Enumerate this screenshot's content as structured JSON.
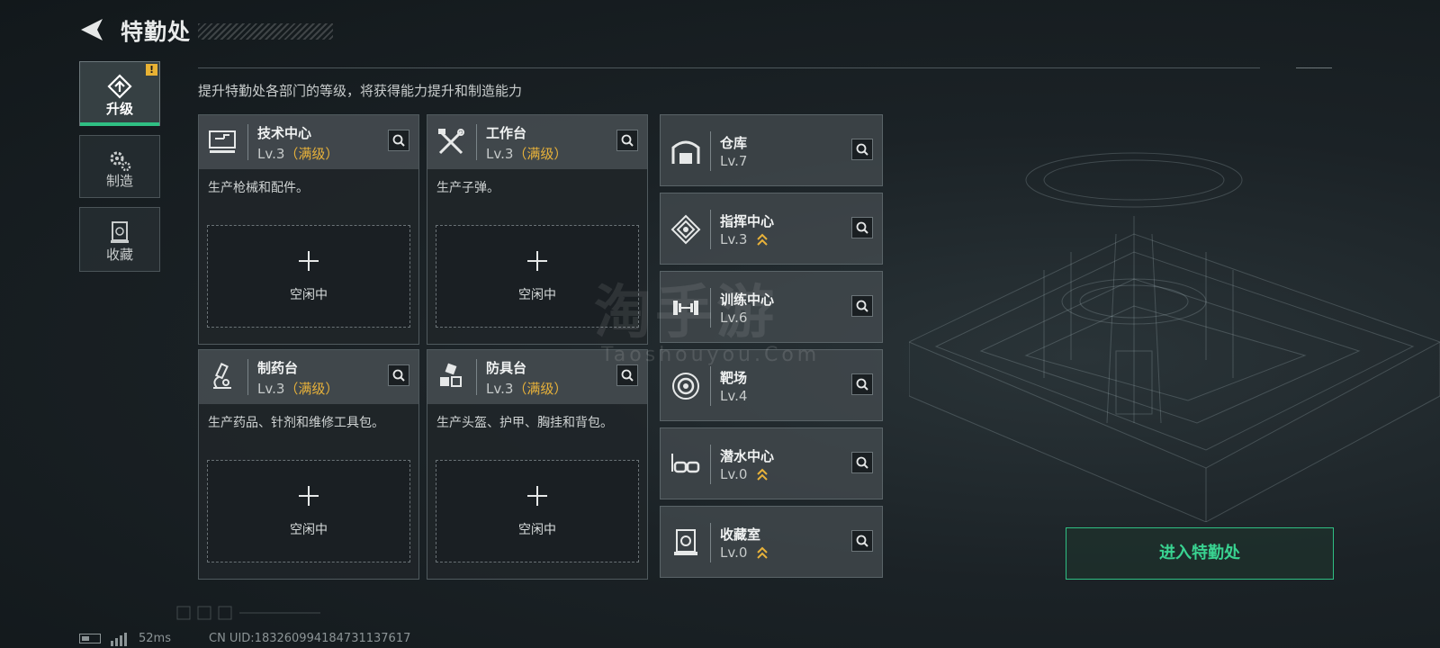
{
  "header": {
    "title": "特勤处"
  },
  "sidebar": {
    "items": [
      {
        "label": "升级",
        "icon": "upgrade-icon",
        "active": true,
        "badge": "!"
      },
      {
        "label": "制造",
        "icon": "gears-icon",
        "active": false
      },
      {
        "label": "收藏",
        "icon": "collection-icon",
        "active": false
      }
    ]
  },
  "subtitle": "提升特勤处各部门的等级，将获得能力提升和制造能力",
  "main_cards": [
    {
      "name": "技术中心",
      "level": "Lv.3",
      "max": "（满级）",
      "desc": "生产枪械和配件。",
      "slot": "空闲中",
      "icon": "computer-icon"
    },
    {
      "name": "工作台",
      "level": "Lv.3",
      "max": "（满级）",
      "desc": "生产子弹。",
      "slot": "空闲中",
      "icon": "tools-icon"
    },
    {
      "name": "制药台",
      "level": "Lv.3",
      "max": "（满级）",
      "desc": "生产药品、针剂和维修工具包。",
      "slot": "空闲中",
      "icon": "microscope-icon"
    },
    {
      "name": "防具台",
      "level": "Lv.3",
      "max": "（满级）",
      "desc": "生产头盔、护甲、胸挂和背包。",
      "slot": "空闲中",
      "icon": "armor-blocks-icon"
    }
  ],
  "side_cards": [
    {
      "name": "仓库",
      "level": "Lv.7",
      "upgradeable": false,
      "icon": "warehouse-icon"
    },
    {
      "name": "指挥中心",
      "level": "Lv.3",
      "upgradeable": true,
      "icon": "chip-icon"
    },
    {
      "name": "训练中心",
      "level": "Lv.6",
      "upgradeable": false,
      "icon": "dumbbell-icon"
    },
    {
      "name": "靶场",
      "level": "Lv.4",
      "upgradeable": false,
      "icon": "target-icon"
    },
    {
      "name": "潜水中心",
      "level": "Lv.0",
      "upgradeable": true,
      "icon": "diving-mask-icon"
    },
    {
      "name": "收藏室",
      "level": "Lv.0",
      "upgradeable": true,
      "icon": "collection-room-icon"
    }
  ],
  "enter_button": "进入特勤处",
  "watermark": {
    "main": "淘手游",
    "sub": "Taoshouyou.Com"
  },
  "status_bar": {
    "ping": "52ms",
    "uid": "CN UID:183260994184731137617"
  },
  "colors": {
    "accent_green": "#2fbf83",
    "max_level_gold": "#e8b23a",
    "badge_yellow": "#e8b234"
  }
}
